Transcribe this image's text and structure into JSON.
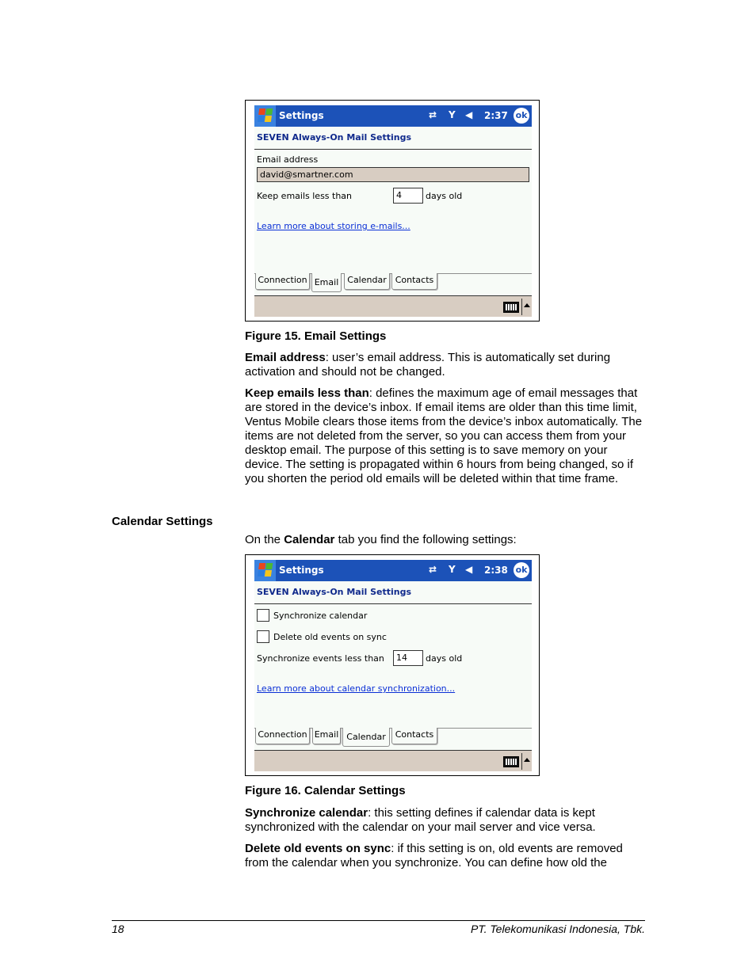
{
  "figure15": {
    "window_title": "Settings",
    "clock": "2:37",
    "ok_label": "ok",
    "subtitle": "SEVEN Always-On Mail Settings",
    "email_label": "Email address",
    "email_value": "david@smartner.com",
    "keep_label": "Keep emails less than",
    "keep_value": "4",
    "keep_suffix": "days old",
    "link": "Learn more about storing e-mails...",
    "tabs": [
      {
        "label": "Connection",
        "active": false
      },
      {
        "label": "Email",
        "active": true
      },
      {
        "label": "Calendar",
        "active": false
      },
      {
        "label": "Contacts",
        "active": false
      }
    ],
    "caption": "Figure 15. Email Settings"
  },
  "figure16": {
    "window_title": "Settings",
    "clock": "2:38",
    "ok_label": "ok",
    "subtitle": "SEVEN Always-On Mail Settings",
    "sync_calendar_label": "Synchronize calendar",
    "sync_calendar_checked": false,
    "delete_old_label": "Delete old events on sync",
    "delete_old_checked": false,
    "sync_less_label": "Synchronize events less than",
    "sync_less_value": "14",
    "sync_less_suffix": "days old",
    "link": "Learn more about calendar synchronization...",
    "tabs": [
      {
        "label": "Connection",
        "active": false
      },
      {
        "label": "Email",
        "active": false
      },
      {
        "label": "Calendar",
        "active": true
      },
      {
        "label": "Contacts",
        "active": false
      }
    ],
    "caption": "Figure 16. Calendar Settings"
  },
  "text": {
    "email_address_term": "Email address",
    "email_address_desc": ": user’s email address. This is automatically set during activation and should not be changed.",
    "keep_emails_term": "Keep emails less than",
    "keep_emails_desc": ": defines the maximum age of email messages that are stored in the device’s inbox. If email items are older than this time limit, Ventus Mobile clears those items from the device’s inbox automatically. The items are not deleted from the server, so you can access them from your desktop email. The purpose of this setting is to save memory on your device. The setting is propagated within 6 hours from being changed, so if you shorten the period old emails will be deleted within that time frame.",
    "calendar_heading": "Calendar Settings",
    "calendar_intro_pre": "On the ",
    "calendar_intro_bold": "Calendar",
    "calendar_intro_post": " tab you find the following settings:",
    "sync_cal_term": "Synchronize calendar",
    "sync_cal_desc": ": this setting defines if calendar data is kept synchronized with the calendar on your mail server and vice versa.",
    "delete_old_term": "Delete old events on sync",
    "delete_old_desc": ": if this setting is on, old events are removed from the calendar when you synchronize. You can define how old the"
  },
  "footer": {
    "page_number": "18",
    "company": "PT. Telekomunikasi Indonesia, Tbk."
  },
  "colors": {
    "titlebar": "#1c52b8",
    "link": "#0a2fd6",
    "subtitle": "#102a8c",
    "menubar": "#d8cdc2"
  }
}
